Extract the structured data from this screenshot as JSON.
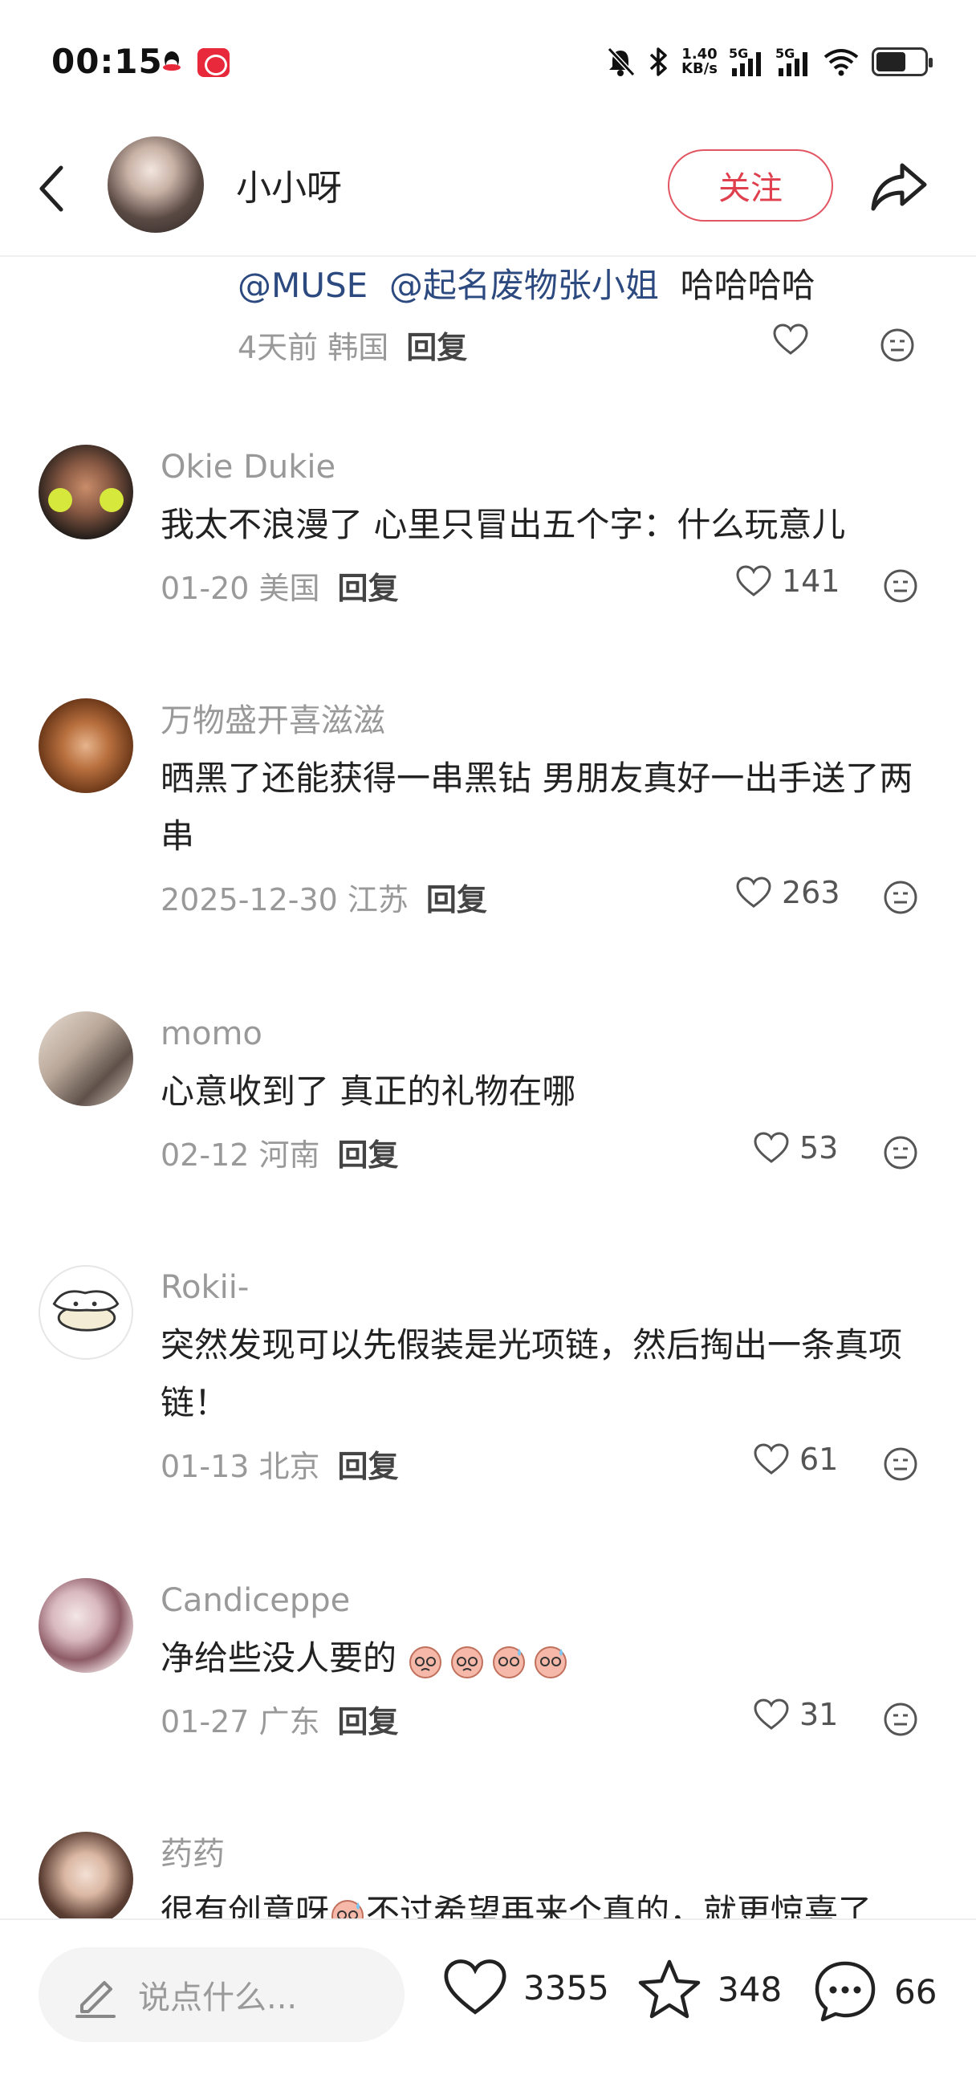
{
  "status_bar": {
    "time": "00:15",
    "net_speed_top": "1.40",
    "net_speed_bottom": "KB/s",
    "sim1": "5G",
    "sim2": "5G",
    "icons": [
      "qq-icon",
      "app-badge-icon",
      "mute-bell-icon",
      "bluetooth-icon",
      "signal-icon",
      "wifi-icon",
      "battery-icon"
    ]
  },
  "header": {
    "user_name": "小小呀",
    "follow_label": "关注",
    "back_icon": "chevron-left-icon",
    "share_icon": "share-icon"
  },
  "top_reply": {
    "mention1": "@MUSE",
    "mention2": "@起名废物张小姐",
    "text": "哈哈哈哈",
    "meta": "4天前 韩国",
    "reply_label": "回复"
  },
  "comments": [
    {
      "name": "Okie Dukie",
      "text": "我太不浪漫了 心里只冒出五个字：什么玩意儿",
      "meta": "01-20 美国",
      "reply_label": "回复",
      "likes": "141"
    },
    {
      "name": "万物盛开喜滋滋",
      "text": "晒黑了还能获得一串黑钻 男朋友真好一出手送了两串",
      "meta": "2025-12-30 江苏",
      "reply_label": "回复",
      "likes": "263"
    },
    {
      "name": "momo",
      "text": "心意收到了 真正的礼物在哪",
      "meta": "02-12 河南",
      "reply_label": "回复",
      "likes": "53"
    },
    {
      "name": "Rokii-",
      "text": "突然发现可以先假装是光项链，然后掏出一条真项链！",
      "meta": "01-13 北京",
      "reply_label": "回复",
      "likes": "61"
    },
    {
      "name": "Candiceppe",
      "text": "净给些没人要的",
      "meta": "01-27 广东",
      "reply_label": "回复",
      "likes": "31"
    },
    {
      "name": "药药",
      "text": "很有创意呀",
      "text_tail": "不过希望再来个真的，就更惊喜了"
    }
  ],
  "bottom_bar": {
    "input_placeholder": "说点什么...",
    "likes": "3355",
    "favorites": "348",
    "comments": "66"
  },
  "colors": {
    "accent_red": "#e0404e",
    "mention_blue": "#2c4a80",
    "muted_gray": "#999999"
  }
}
